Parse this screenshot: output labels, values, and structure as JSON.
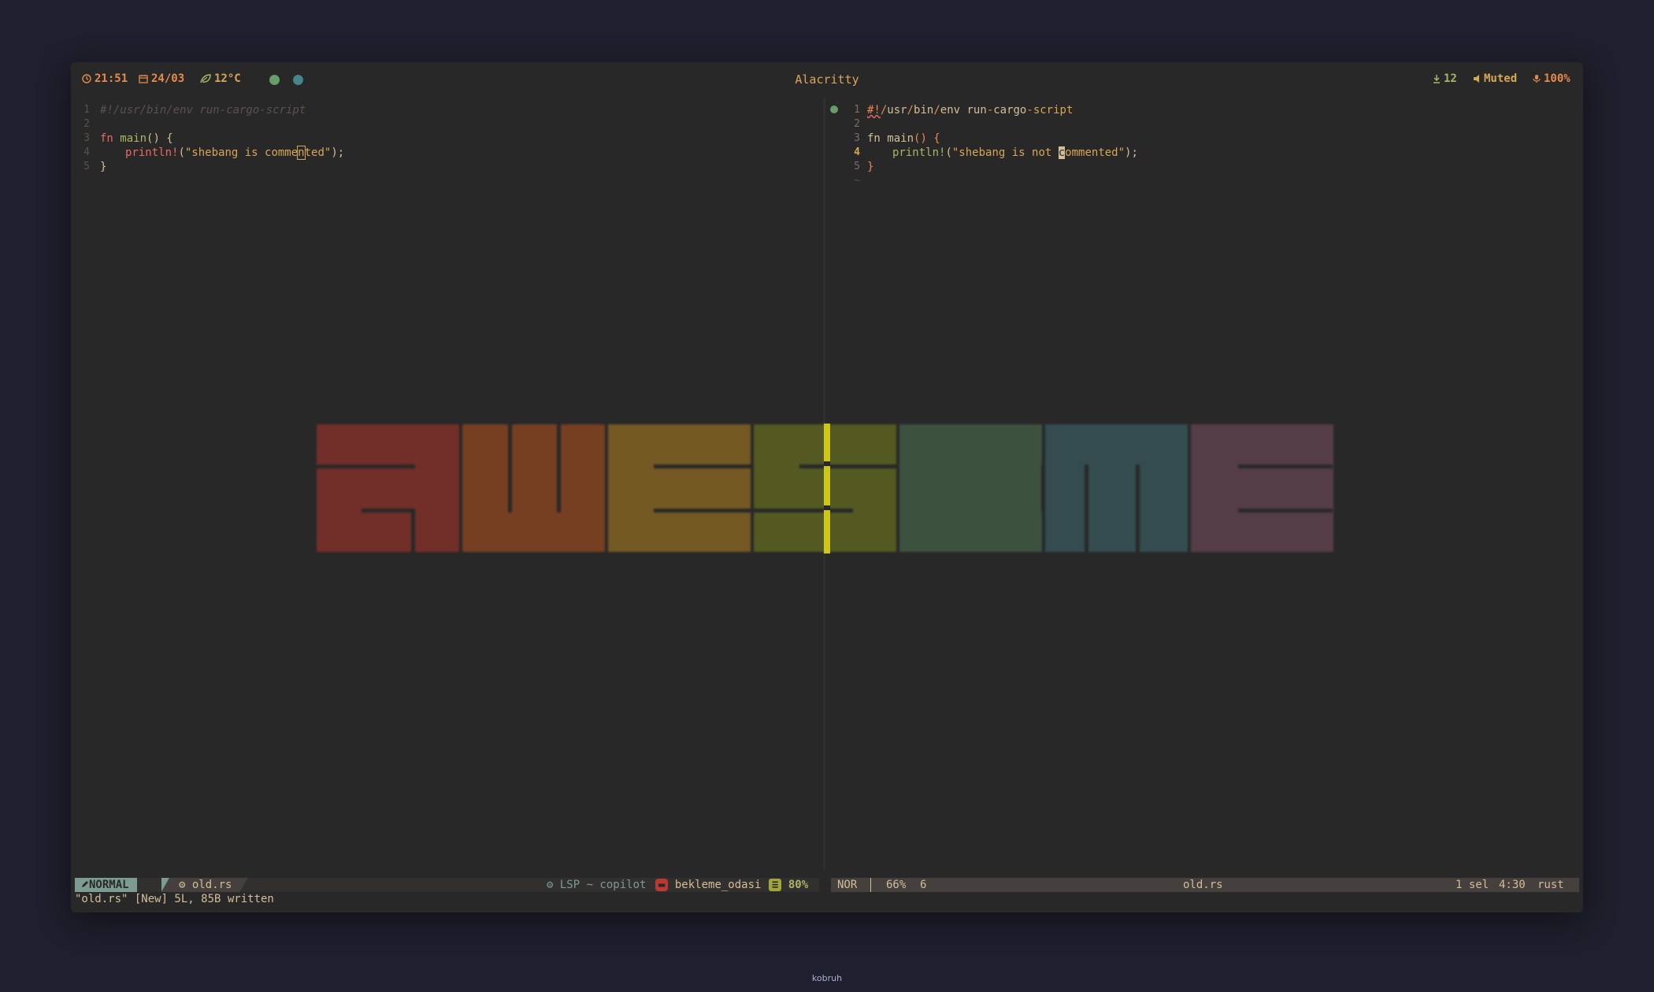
{
  "topbar": {
    "time": "21:51",
    "date": "24/03",
    "weather": "12°C",
    "title": "Alacritty",
    "downloads": "12",
    "volume": "Muted",
    "battery": "100%",
    "colors": {
      "orange": "#e78a4e",
      "green": "#a9b665",
      "yellow": "#d8a657",
      "dot1": "#689d6a",
      "dot2": "#458588"
    }
  },
  "left_pane": {
    "line_numbers": [
      "1",
      "2",
      "3",
      "4",
      "5"
    ],
    "code": {
      "l1": "#!/usr/bin/env run-cargo-script",
      "l3_kw": "fn",
      "l3_fn": " main",
      "l3_rest": "() {",
      "l4_mac": "println!",
      "l4_open": "(",
      "l4_str_a": "\"shebang is comme",
      "l4_cursor": "n",
      "l4_str_b": "ted\"",
      "l4_close": ");",
      "l5": "}"
    }
  },
  "right_pane": {
    "line_numbers": [
      "1",
      "2",
      "3",
      "4",
      "5",
      "~"
    ],
    "code": {
      "l1_a": "#!",
      "l1_b": "/",
      "l1_c": "usr",
      "l1_d": "/",
      "l1_e": "bin",
      "l1_f": "/",
      "l1_g": "env run",
      "l1_h": "-",
      "l1_i": "cargo",
      "l1_j": "-",
      "l1_k": "script",
      "l3_kw": "fn",
      "l3_fn": " main",
      "l3_rest": "() {",
      "l4_mac": "println!",
      "l4_open": "(",
      "l4_str_a": "\"shebang is not ",
      "l4_cursor": "c",
      "l4_str_b": "ommented\"",
      "l4_close": ");",
      "l5": "}"
    }
  },
  "logo_colors": [
    "#b0332a",
    "#b7531c",
    "#b5811f",
    "#78821e",
    "#4f7353",
    "#3f6b70",
    "#7a4f63"
  ],
  "status_left": {
    "mode": "NORMAL",
    "file": "old.rs",
    "lsp": "LSP ~ copilot",
    "branch": "bekleme_odasi",
    "percent": "80%"
  },
  "status_right": {
    "mode": "NOR",
    "percent": "66%",
    "count": "6",
    "file": "old.rs",
    "sel": "1 sel",
    "pos": "4:30",
    "lang": "rust"
  },
  "message": "\"old.rs\" [New] 5L, 85B written",
  "footer": "kobruh"
}
